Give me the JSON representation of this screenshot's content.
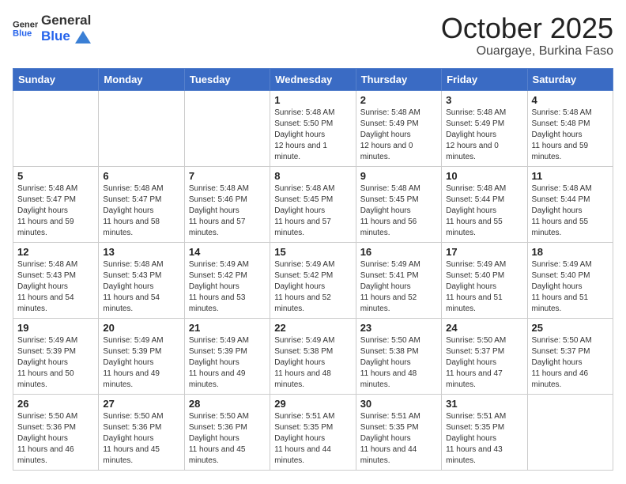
{
  "header": {
    "logo_general": "General",
    "logo_blue": "Blue",
    "month_title": "October 2025",
    "location": "Ouargaye, Burkina Faso"
  },
  "weekdays": [
    "Sunday",
    "Monday",
    "Tuesday",
    "Wednesday",
    "Thursday",
    "Friday",
    "Saturday"
  ],
  "weeks": [
    [
      {
        "day": "",
        "empty": true
      },
      {
        "day": "",
        "empty": true
      },
      {
        "day": "",
        "empty": true
      },
      {
        "day": "1",
        "sunrise": "5:48 AM",
        "sunset": "5:50 PM",
        "daylight": "12 hours and 1 minute."
      },
      {
        "day": "2",
        "sunrise": "5:48 AM",
        "sunset": "5:49 PM",
        "daylight": "12 hours and 0 minutes."
      },
      {
        "day": "3",
        "sunrise": "5:48 AM",
        "sunset": "5:49 PM",
        "daylight": "12 hours and 0 minutes."
      },
      {
        "day": "4",
        "sunrise": "5:48 AM",
        "sunset": "5:48 PM",
        "daylight": "11 hours and 59 minutes."
      }
    ],
    [
      {
        "day": "5",
        "sunrise": "5:48 AM",
        "sunset": "5:47 PM",
        "daylight": "11 hours and 59 minutes."
      },
      {
        "day": "6",
        "sunrise": "5:48 AM",
        "sunset": "5:47 PM",
        "daylight": "11 hours and 58 minutes."
      },
      {
        "day": "7",
        "sunrise": "5:48 AM",
        "sunset": "5:46 PM",
        "daylight": "11 hours and 57 minutes."
      },
      {
        "day": "8",
        "sunrise": "5:48 AM",
        "sunset": "5:45 PM",
        "daylight": "11 hours and 57 minutes."
      },
      {
        "day": "9",
        "sunrise": "5:48 AM",
        "sunset": "5:45 PM",
        "daylight": "11 hours and 56 minutes."
      },
      {
        "day": "10",
        "sunrise": "5:48 AM",
        "sunset": "5:44 PM",
        "daylight": "11 hours and 55 minutes."
      },
      {
        "day": "11",
        "sunrise": "5:48 AM",
        "sunset": "5:44 PM",
        "daylight": "11 hours and 55 minutes."
      }
    ],
    [
      {
        "day": "12",
        "sunrise": "5:48 AM",
        "sunset": "5:43 PM",
        "daylight": "11 hours and 54 minutes."
      },
      {
        "day": "13",
        "sunrise": "5:48 AM",
        "sunset": "5:43 PM",
        "daylight": "11 hours and 54 minutes."
      },
      {
        "day": "14",
        "sunrise": "5:49 AM",
        "sunset": "5:42 PM",
        "daylight": "11 hours and 53 minutes."
      },
      {
        "day": "15",
        "sunrise": "5:49 AM",
        "sunset": "5:42 PM",
        "daylight": "11 hours and 52 minutes."
      },
      {
        "day": "16",
        "sunrise": "5:49 AM",
        "sunset": "5:41 PM",
        "daylight": "11 hours and 52 minutes."
      },
      {
        "day": "17",
        "sunrise": "5:49 AM",
        "sunset": "5:40 PM",
        "daylight": "11 hours and 51 minutes."
      },
      {
        "day": "18",
        "sunrise": "5:49 AM",
        "sunset": "5:40 PM",
        "daylight": "11 hours and 51 minutes."
      }
    ],
    [
      {
        "day": "19",
        "sunrise": "5:49 AM",
        "sunset": "5:39 PM",
        "daylight": "11 hours and 50 minutes."
      },
      {
        "day": "20",
        "sunrise": "5:49 AM",
        "sunset": "5:39 PM",
        "daylight": "11 hours and 49 minutes."
      },
      {
        "day": "21",
        "sunrise": "5:49 AM",
        "sunset": "5:39 PM",
        "daylight": "11 hours and 49 minutes."
      },
      {
        "day": "22",
        "sunrise": "5:49 AM",
        "sunset": "5:38 PM",
        "daylight": "11 hours and 48 minutes."
      },
      {
        "day": "23",
        "sunrise": "5:50 AM",
        "sunset": "5:38 PM",
        "daylight": "11 hours and 48 minutes."
      },
      {
        "day": "24",
        "sunrise": "5:50 AM",
        "sunset": "5:37 PM",
        "daylight": "11 hours and 47 minutes."
      },
      {
        "day": "25",
        "sunrise": "5:50 AM",
        "sunset": "5:37 PM",
        "daylight": "11 hours and 46 minutes."
      }
    ],
    [
      {
        "day": "26",
        "sunrise": "5:50 AM",
        "sunset": "5:36 PM",
        "daylight": "11 hours and 46 minutes."
      },
      {
        "day": "27",
        "sunrise": "5:50 AM",
        "sunset": "5:36 PM",
        "daylight": "11 hours and 45 minutes."
      },
      {
        "day": "28",
        "sunrise": "5:50 AM",
        "sunset": "5:36 PM",
        "daylight": "11 hours and 45 minutes."
      },
      {
        "day": "29",
        "sunrise": "5:51 AM",
        "sunset": "5:35 PM",
        "daylight": "11 hours and 44 minutes."
      },
      {
        "day": "30",
        "sunrise": "5:51 AM",
        "sunset": "5:35 PM",
        "daylight": "11 hours and 44 minutes."
      },
      {
        "day": "31",
        "sunrise": "5:51 AM",
        "sunset": "5:35 PM",
        "daylight": "11 hours and 43 minutes."
      },
      {
        "day": "",
        "empty": true
      }
    ]
  ]
}
